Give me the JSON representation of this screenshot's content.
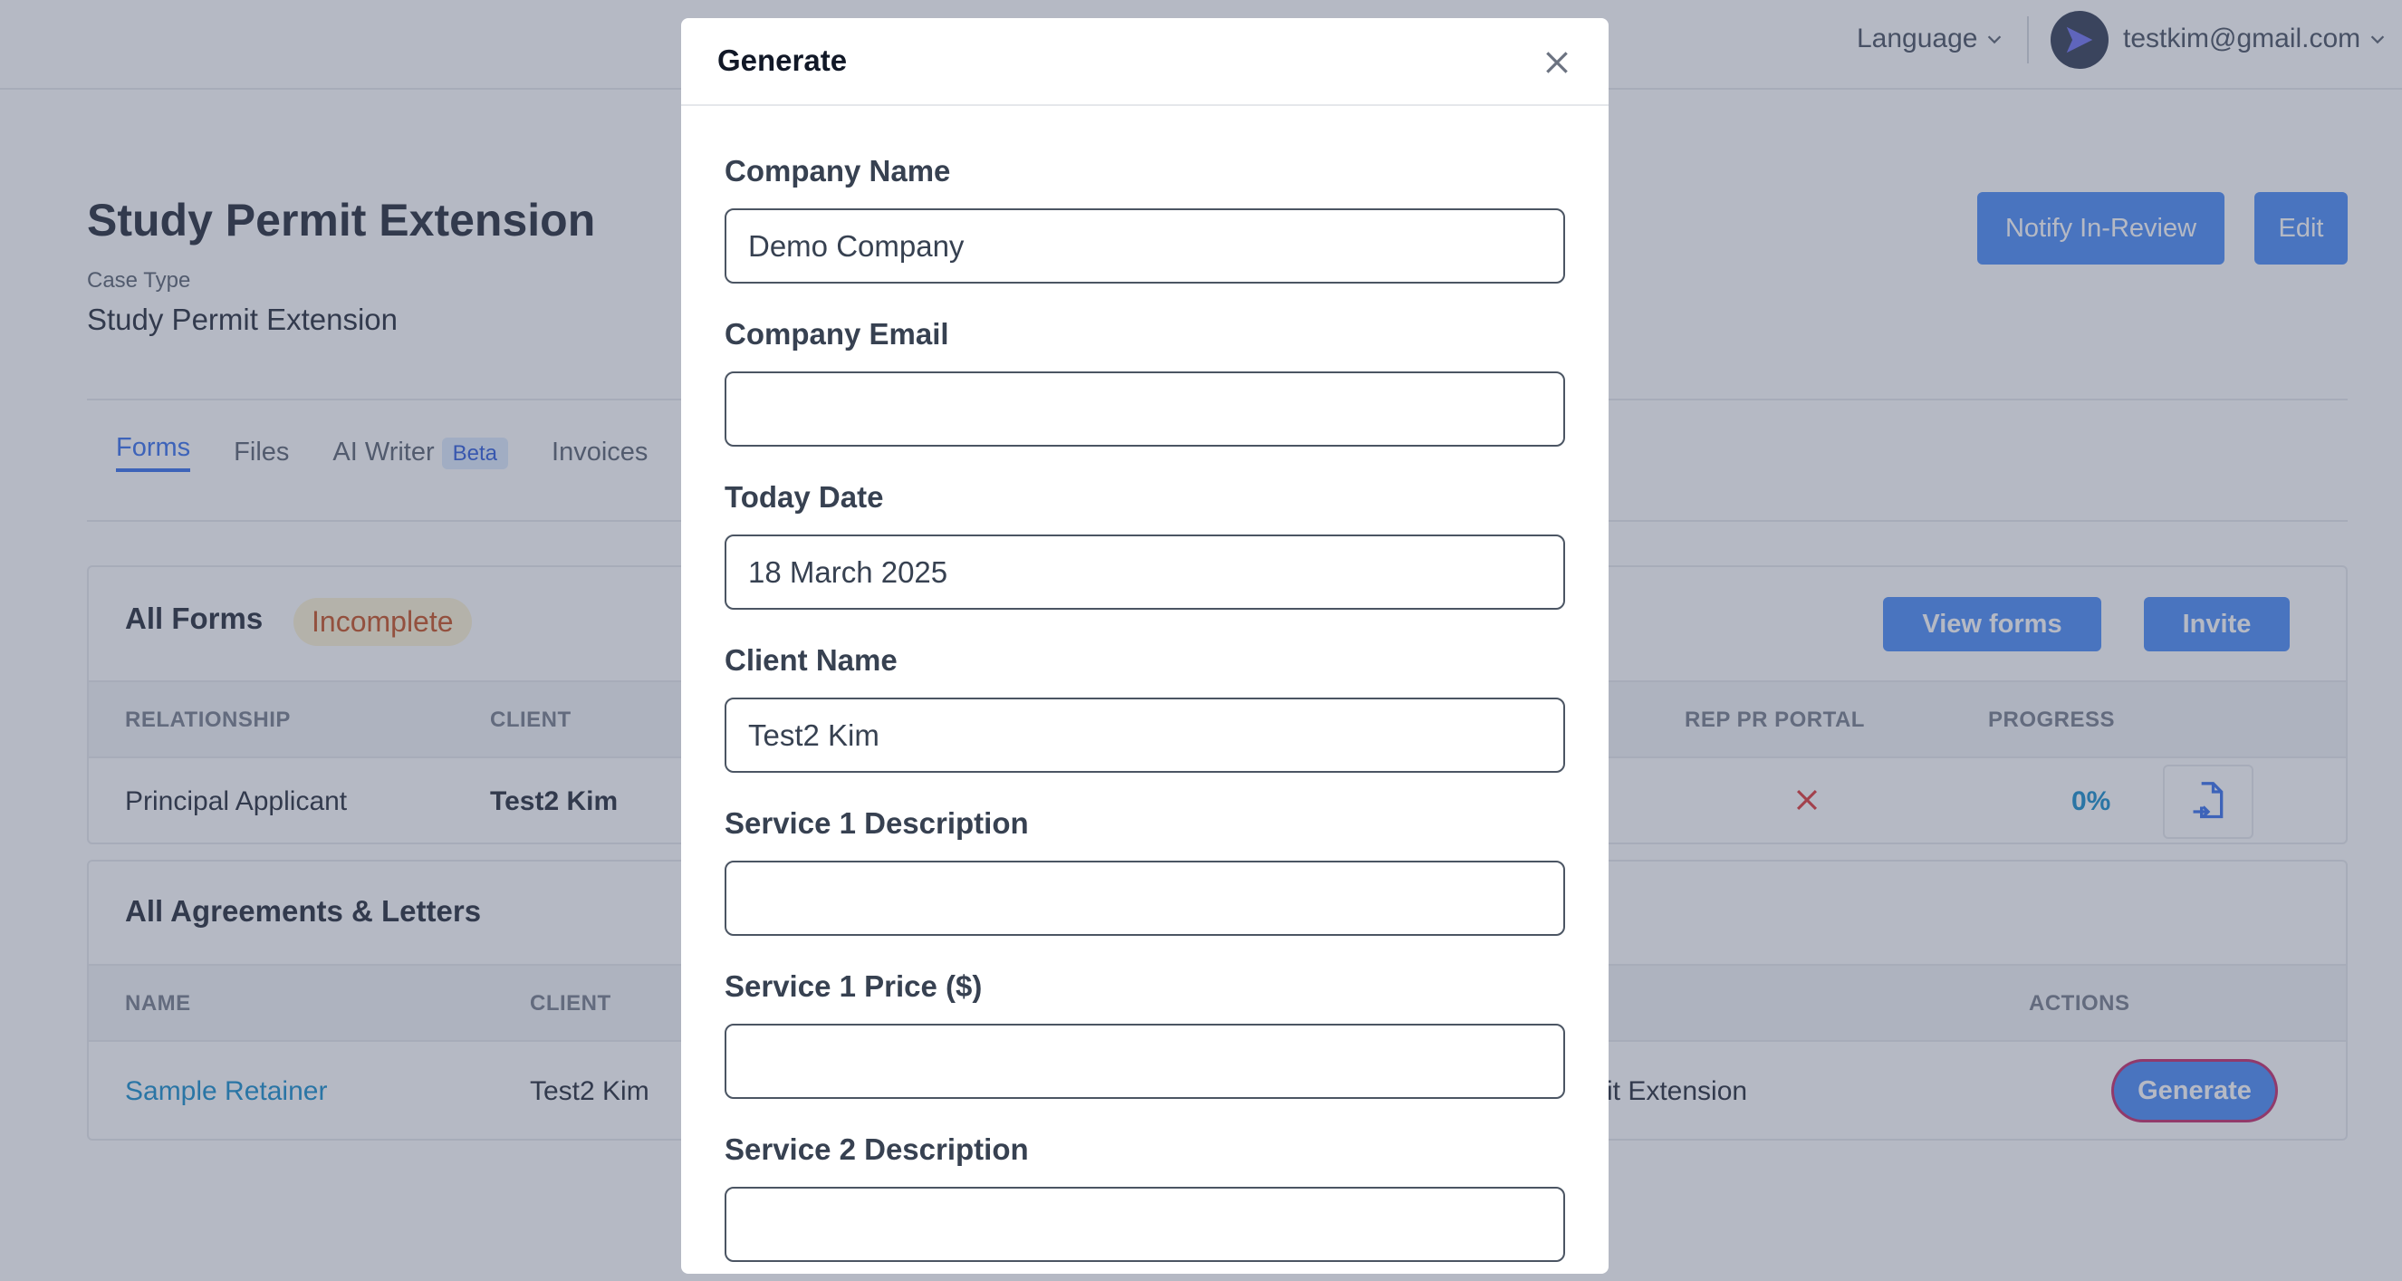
{
  "header": {
    "language_label": "Language",
    "user_email": "testkim@gmail.com"
  },
  "page": {
    "title": "Study Permit Extension",
    "case_type_label": "Case Type",
    "case_type_value": "Study Permit Extension",
    "notify_label": "Notify In-Review",
    "edit_label": "Edit"
  },
  "tabs": [
    {
      "label": "Forms",
      "active": true
    },
    {
      "label": "Files"
    },
    {
      "label": "AI Writer",
      "badge": "Beta"
    },
    {
      "label": "Invoices"
    }
  ],
  "forms_card": {
    "title": "All Forms",
    "status_badge": "Incomplete",
    "view_forms_label": "View forms",
    "invite_label": "Invite",
    "columns": [
      "RELATIONSHIP",
      "CLIENT",
      "REP PR PORTAL",
      "PROGRESS"
    ],
    "row": {
      "relationship": "Principal Applicant",
      "client": "Test2 Kim",
      "progress": "0%"
    }
  },
  "agreements_card": {
    "title": "All Agreements & Letters",
    "columns": [
      "NAME",
      "CLIENT",
      "ACTIONS"
    ],
    "row": {
      "name": "Sample Retainer",
      "client": "Test2 Kim",
      "case_type_partial": "rmit Extension",
      "action_label": "Generate"
    }
  },
  "modal": {
    "title": "Generate",
    "fields": [
      {
        "label": "Company Name",
        "value": "Demo Company"
      },
      {
        "label": "Company Email",
        "value": ""
      },
      {
        "label": "Today Date",
        "value": "18 March 2025"
      },
      {
        "label": "Client Name",
        "value": "Test2 Kim"
      },
      {
        "label": "Service 1 Description",
        "value": ""
      },
      {
        "label": "Service 1 Price ($)",
        "value": ""
      },
      {
        "label": "Service 2 Description",
        "value": ""
      }
    ]
  },
  "colors": {
    "primary": "#3b82f6",
    "link": "#0284c7",
    "warning_bg": "#fdf3d0",
    "warning_text": "#c2410c"
  }
}
